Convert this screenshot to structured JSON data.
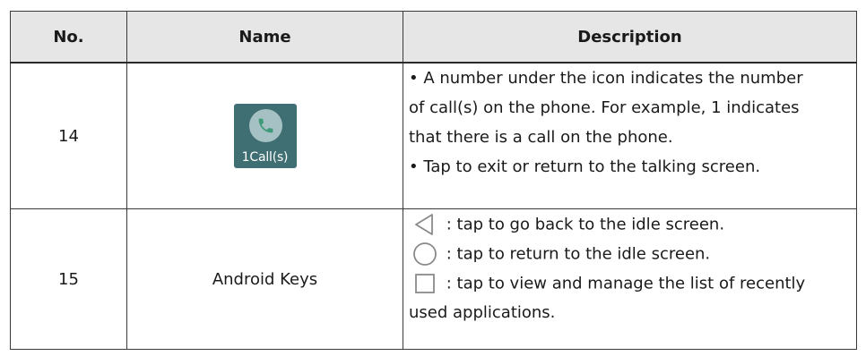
{
  "table": {
    "headers": {
      "no": "No.",
      "name": "Name",
      "description": "Description"
    },
    "rows": [
      {
        "no": "14",
        "name_icon": {
          "icon": "call-app-icon",
          "label": "1Call(s)"
        },
        "description_lines": [
          "• A number under the icon indicates the number",
          "of call(s) on the phone. For example, 1 indicates",
          "that there is a call on the phone.",
          "• Tap to exit or return to the talking screen."
        ]
      },
      {
        "no": "15",
        "name": "Android Keys",
        "keys": [
          {
            "icon": "back-key-icon",
            "text": ": tap to go back to the idle screen."
          },
          {
            "icon": "home-key-icon",
            "text": ": tap to return to the idle screen."
          },
          {
            "icon": "recent-apps-key-icon",
            "text": ": tap to view and manage the list of recently"
          }
        ],
        "continuation": "used applications."
      }
    ]
  },
  "colors": {
    "header_background": "#e6e6e6",
    "border": "#3a3a3a",
    "icon_background": "#3f6f73",
    "icon_bubble": "#a6c1c3",
    "key_stroke": "#8a8a8a"
  }
}
